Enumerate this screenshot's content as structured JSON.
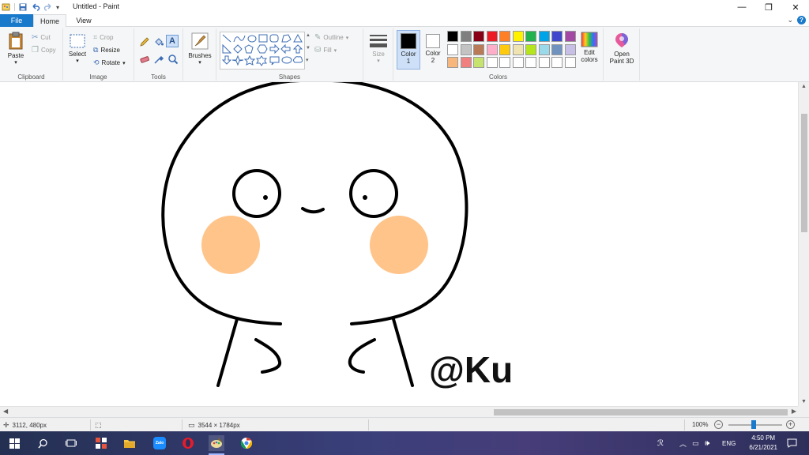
{
  "window": {
    "title": "Untitled - Paint",
    "minimize_glyph": "—",
    "restore_glyph": "❐",
    "close_glyph": "✕"
  },
  "tabs": {
    "file": "File",
    "home": "Home",
    "view": "View"
  },
  "ribbon": {
    "clipboard": {
      "label": "Clipboard",
      "paste": "Paste",
      "cut": "Cut",
      "copy": "Copy"
    },
    "image": {
      "label": "Image",
      "select": "Select",
      "crop": "Crop",
      "resize": "Resize",
      "rotate": "Rotate"
    },
    "tools": {
      "label": "Tools"
    },
    "brushes": {
      "label": "Brushes"
    },
    "shapes": {
      "label": "Shapes",
      "outline": "Outline",
      "fill": "Fill"
    },
    "size": {
      "label": "Size"
    },
    "colors": {
      "label": "Colors",
      "color1": "Color",
      "color1_num": "1",
      "color2": "Color",
      "color2_num": "2",
      "edit_colors_1": "Edit",
      "edit_colors_2": "colors",
      "palette_row1": [
        "#000000",
        "#7f7f7f",
        "#880015",
        "#ed1c24",
        "#ff7f27",
        "#fff200",
        "#22b14c",
        "#00a2e8",
        "#3f48cc",
        "#a349a4"
      ],
      "palette_row2": [
        "#ffffff",
        "#c3c3c3",
        "#b97a57",
        "#ffaec9",
        "#ffc90e",
        "#efe4b0",
        "#b5e61d",
        "#99d9ea",
        "#7092be",
        "#c8bfe7"
      ],
      "palette_row3": [
        "#f7b77c",
        "#f08080",
        "#c6e36f",
        "#ffffff",
        "#ffffff",
        "#ffffff",
        "#ffffff",
        "#ffffff",
        "#ffffff",
        "#ffffff"
      ]
    },
    "paint3d": {
      "line1": "Open",
      "line2": "Paint 3D"
    }
  },
  "canvas": {
    "watermark": "@Ku",
    "blush_color": "#ffc48a"
  },
  "status": {
    "cursor": "3112, 480px",
    "dimensions": "3544 × 1784px",
    "zoom": "100%"
  },
  "taskbar": {
    "language": "ENG",
    "time": "4:50 PM",
    "date": "6/21/2021"
  }
}
